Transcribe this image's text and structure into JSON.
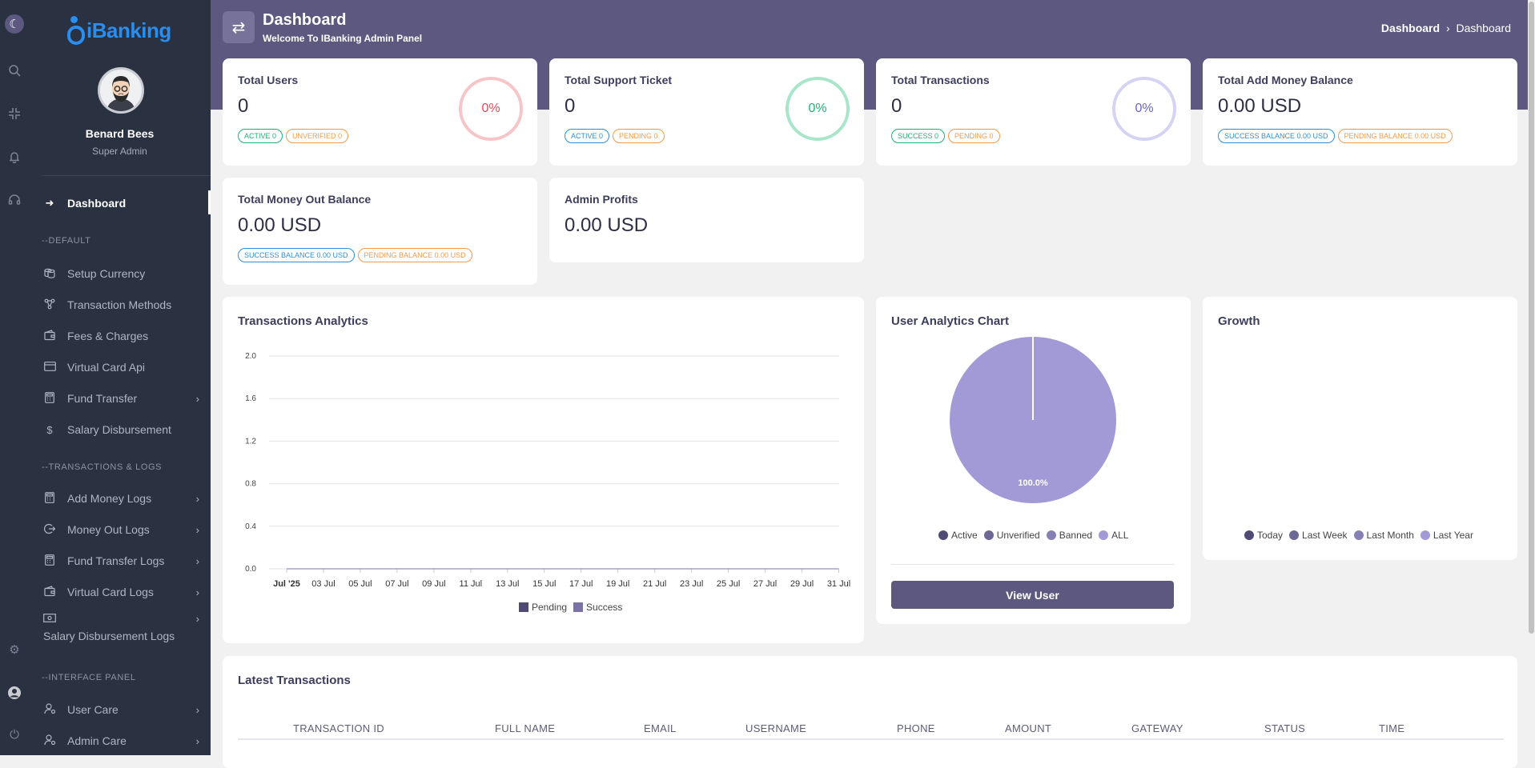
{
  "rail": {
    "icons": [
      "theme-toggle-icon",
      "search-icon",
      "fullscreen-exit-icon",
      "bell-icon",
      "headset-icon",
      "gear-icon",
      "user-circle-icon",
      "power-icon"
    ]
  },
  "sidebar": {
    "brand": "iBanking",
    "user_name": "Benard Bees",
    "user_role": "Super Admin",
    "dashboard_label": "Dashboard",
    "sections": {
      "default": "--DEFAULT",
      "transactions": "--TRANSACTIONS & LOGS",
      "interface": "--INTERFACE PANEL"
    },
    "items": {
      "setup_currency": "Setup Currency",
      "transaction_methods": "Transaction Methods",
      "fees_charges": "Fees & Charges",
      "virtual_card_api": "Virtual Card Api",
      "fund_transfer": "Fund Transfer",
      "salary_disbursement": "Salary Disbursement",
      "add_money_logs": "Add Money Logs",
      "money_out_logs": "Money Out Logs",
      "fund_transfer_logs": "Fund Transfer Logs",
      "virtual_card_logs": "Virtual Card Logs",
      "salary_disbursement_logs": "Salary Disbursement Logs",
      "user_care": "User Care",
      "admin_care": "Admin Care"
    }
  },
  "header": {
    "title": "Dashboard",
    "subtitle": "Welcome To IBanking Admin Panel",
    "breadcrumb_root": "Dashboard",
    "breadcrumb_sep": "›",
    "breadcrumb_current": "Dashboard"
  },
  "stats": {
    "users": {
      "label": "Total Users",
      "value": "0",
      "percent": "0%",
      "badge1": "ACTIVE 0",
      "badge2": "UNVERIFIED 0"
    },
    "tickets": {
      "label": "Total Support Ticket",
      "value": "0",
      "percent": "0%",
      "badge1": "ACTIVE 0",
      "badge2": "PENDING 0"
    },
    "transactions": {
      "label": "Total Transactions",
      "value": "0",
      "percent": "0%",
      "badge1": "SUCCESS 0",
      "badge2": "PENDING 0"
    },
    "add_money": {
      "label": "Total Add Money Balance",
      "value": "0.00 USD",
      "badge1": "SUCCESS BALANCE 0.00 USD",
      "badge2": "PENDING BALANCE 0.00 USD"
    },
    "money_out": {
      "label": "Total Money Out Balance",
      "value": "0.00 USD",
      "badge1": "SUCCESS BALANCE 0.00 USD",
      "badge2": "PENDING BALANCE 0.00 USD"
    },
    "profits": {
      "label": "Admin Profits",
      "value": "0.00 USD"
    }
  },
  "colors": {
    "primary": "#5c5880",
    "sidebar": "#2a3140",
    "success": "#1bb374",
    "warning": "#f39a4a",
    "info": "#2f8fd6",
    "danger": "#e5485b"
  },
  "analytics": {
    "title": "Transactions Analytics",
    "legend": [
      "Pending",
      "Success"
    ]
  },
  "user_chart": {
    "title": "User Analytics Chart",
    "slice_label": "100.0%",
    "legend": [
      "Active",
      "Unverified",
      "Banned",
      "ALL"
    ],
    "button": "View User"
  },
  "growth": {
    "title": "Growth",
    "legend": [
      "Today",
      "Last Week",
      "Last Month",
      "Last Year"
    ]
  },
  "latest": {
    "title": "Latest Transactions",
    "columns": [
      "TRANSACTION ID",
      "FULL NAME",
      "EMAIL",
      "USERNAME",
      "PHONE",
      "AMOUNT",
      "GATEWAY",
      "STATUS",
      "TIME"
    ]
  },
  "chart_data": [
    {
      "type": "area",
      "title": "Transactions Analytics",
      "x": [
        "Jul '25",
        "03 Jul",
        "05 Jul",
        "07 Jul",
        "09 Jul",
        "11 Jul",
        "13 Jul",
        "15 Jul",
        "17 Jul",
        "19 Jul",
        "21 Jul",
        "23 Jul",
        "25 Jul",
        "27 Jul",
        "29 Jul",
        "31 Jul"
      ],
      "series": [
        {
          "name": "Pending",
          "values": [
            0,
            0,
            0,
            0,
            0,
            0,
            0,
            0,
            0,
            0,
            0,
            0,
            0,
            0,
            0,
            0
          ]
        },
        {
          "name": "Success",
          "values": [
            0,
            0,
            0,
            0,
            0,
            0,
            0,
            0,
            0,
            0,
            0,
            0,
            0,
            0,
            0,
            0
          ]
        }
      ],
      "ylim": [
        0,
        2.0
      ],
      "yticks": [
        "0.0",
        "0.4",
        "0.8",
        "1.2",
        "1.6",
        "2.0"
      ],
      "grid": true,
      "legend_position": "bottom"
    },
    {
      "type": "pie",
      "title": "User Analytics Chart",
      "categories": [
        "Active",
        "Unverified",
        "Banned",
        "ALL"
      ],
      "values": [
        0,
        0,
        0,
        100
      ],
      "data_label": "100.0%",
      "legend_position": "bottom"
    }
  ]
}
